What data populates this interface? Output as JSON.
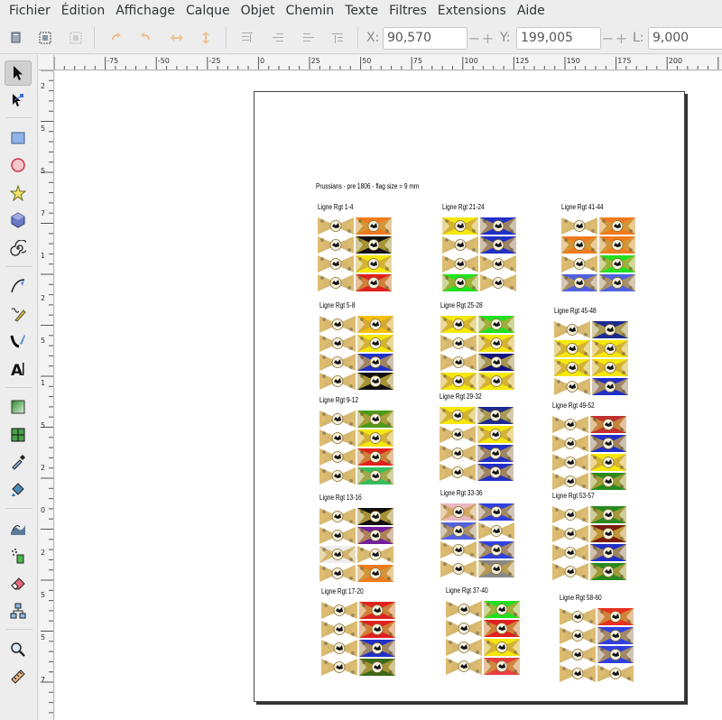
{
  "menubar": {
    "items": [
      "Fichier",
      "Édition",
      "Affichage",
      "Calque",
      "Objet",
      "Chemin",
      "Texte",
      "Filtres",
      "Extensions",
      "Aide"
    ]
  },
  "toolbar": {
    "x_label": "X:",
    "x_value": "90,570",
    "y_label": "Y:",
    "y_value": "199,005",
    "w_label": "L:",
    "w_value": "9,000",
    "minus": "−",
    "plus": "+"
  },
  "tools": [
    "selector-tool-icon",
    "node-tool-icon",
    "rectangle-tool-icon",
    "ellipse-tool-icon",
    "star-tool-icon",
    "3dbox-tool-icon",
    "spiral-tool-icon",
    "pen-tool-icon",
    "pencil-tool-icon",
    "calligraphy-tool-icon",
    "text-tool-icon",
    "gradient-tool-icon",
    "mesh-tool-icon",
    "dropper-tool-icon",
    "paint-bucket-tool-icon",
    "tweak-tool-icon",
    "spray-tool-icon",
    "eraser-tool-icon",
    "connector-tool-icon",
    "zoom-tool-icon",
    "measure-tool-icon"
  ],
  "rulers": {
    "horizontal": [
      "-75",
      "-50",
      "-25",
      "0",
      "25",
      "50",
      "75",
      "100",
      "125",
      "150",
      "175",
      "200"
    ],
    "vertical": [
      "2",
      "5",
      "5",
      "7",
      "1",
      "2",
      "5",
      "1",
      "5",
      "2",
      "0",
      "2",
      "5",
      "5",
      "7"
    ]
  },
  "document": {
    "title": "Prussians - pre 1806 - flag size = 9 mm",
    "groups": [
      {
        "label": "Ligne Rgt 1-4",
        "colors": [
          "#ffffff",
          "#f07a1e",
          "#ffffff",
          "#111111",
          "#ffffff",
          "#f5e80c",
          "#ffffff",
          "#e02020"
        ]
      },
      {
        "label": "Ligne Rgt 21-24",
        "colors": [
          "#f5e80c",
          "#2030c8",
          "#ffffff",
          "#2030c8",
          "#ffffff",
          "#ffffff",
          "#20e020",
          "#ffffff"
        ]
      },
      {
        "label": "Ligne Rgt 41-44",
        "colors": [
          "#ffffff",
          "#f07a1e",
          "#f07a1e",
          "#f07a1e",
          "#ffffff",
          "#20e020",
          "#5060e0",
          "#5060e0"
        ]
      },
      {
        "label": "Ligne Rgt 5-8",
        "colors": [
          "#ffffff",
          "#f5c00c",
          "#ffffff",
          "#f5e80c",
          "#ffffff",
          "#2030c8",
          "#ffffff",
          "#111111"
        ]
      },
      {
        "label": "Ligne Rgt 25-28",
        "colors": [
          "#f5e80c",
          "#20e020",
          "#ffffff",
          "#f5e80c",
          "#ffffff",
          "#101080",
          "#f5e80c",
          "#f5e80c"
        ]
      },
      {
        "label": "Ligne Rgt 45-48",
        "colors": [
          "#ffffff",
          "#1a2a90",
          "#f5e80c",
          "#f5e80c",
          "#f5e80c",
          "#f5e80c",
          "#ffffff",
          "#2030c8"
        ]
      },
      {
        "label": "Ligne Rgt 9-12",
        "colors": [
          "#ffffff",
          "#4a9a18",
          "#ffffff",
          "#f5e80c",
          "#ffffff",
          "#e02020",
          "#ffffff",
          "#30c060"
        ]
      },
      {
        "label": "Ligne Rgt 29-32",
        "colors": [
          "#f5e80c",
          "#1a2a90",
          "#ffffff",
          "#f5e80c",
          "#ffffff",
          "#2030c8",
          "#ffffff",
          "#2030c8"
        ]
      },
      {
        "label": "Ligne Rgt 49-52",
        "colors": [
          "#ffffff",
          "#c03030",
          "#ffffff",
          "#2030c8",
          "#ffffff",
          "#f5e80c",
          "#ffffff",
          "#2a8a20"
        ]
      },
      {
        "label": "Ligne Rgt 13-16",
        "colors": [
          "#ffffff",
          "#111111",
          "#ffffff",
          "#7020a0",
          "#eeeeee",
          "#ffffff",
          "#ffffff",
          "#f07a1e"
        ]
      },
      {
        "label": "Ligne Rgt 33-36",
        "colors": [
          "#e8b8c0",
          "#3040e0",
          "#5060e0",
          "#ffffff",
          "#ffffff",
          "#3040e0",
          "#ffffff",
          "#888888"
        ]
      },
      {
        "label": "Ligne Rgt 53-57",
        "colors": [
          "#ffffff",
          "#2a8a20",
          "#ffffff",
          "#7a1a10",
          "#ffffff",
          "#2030c8",
          "#ffffff",
          "#2a8a20"
        ]
      },
      {
        "label": "Ligne Rgt 17-20",
        "colors": [
          "#ffffff",
          "#e02020",
          "#ffffff",
          "#e02020",
          "#ffffff",
          "#2030c8",
          "#ffffff",
          "#3a6a18"
        ]
      },
      {
        "label": "Ligne Rgt 37-40",
        "colors": [
          "#ffffff",
          "#20e020",
          "#ffffff",
          "#e02020",
          "#ffffff",
          "#f5e80c",
          "#ffffff",
          "#e84040"
        ]
      },
      {
        "label": "Ligne Rgt 58-60",
        "colors": [
          "#ffffff",
          "#e83020",
          "#ffffff",
          "#3040e0",
          "#ffffff",
          "#3040e0",
          "#ffffff",
          "#ffffff"
        ]
      }
    ]
  }
}
